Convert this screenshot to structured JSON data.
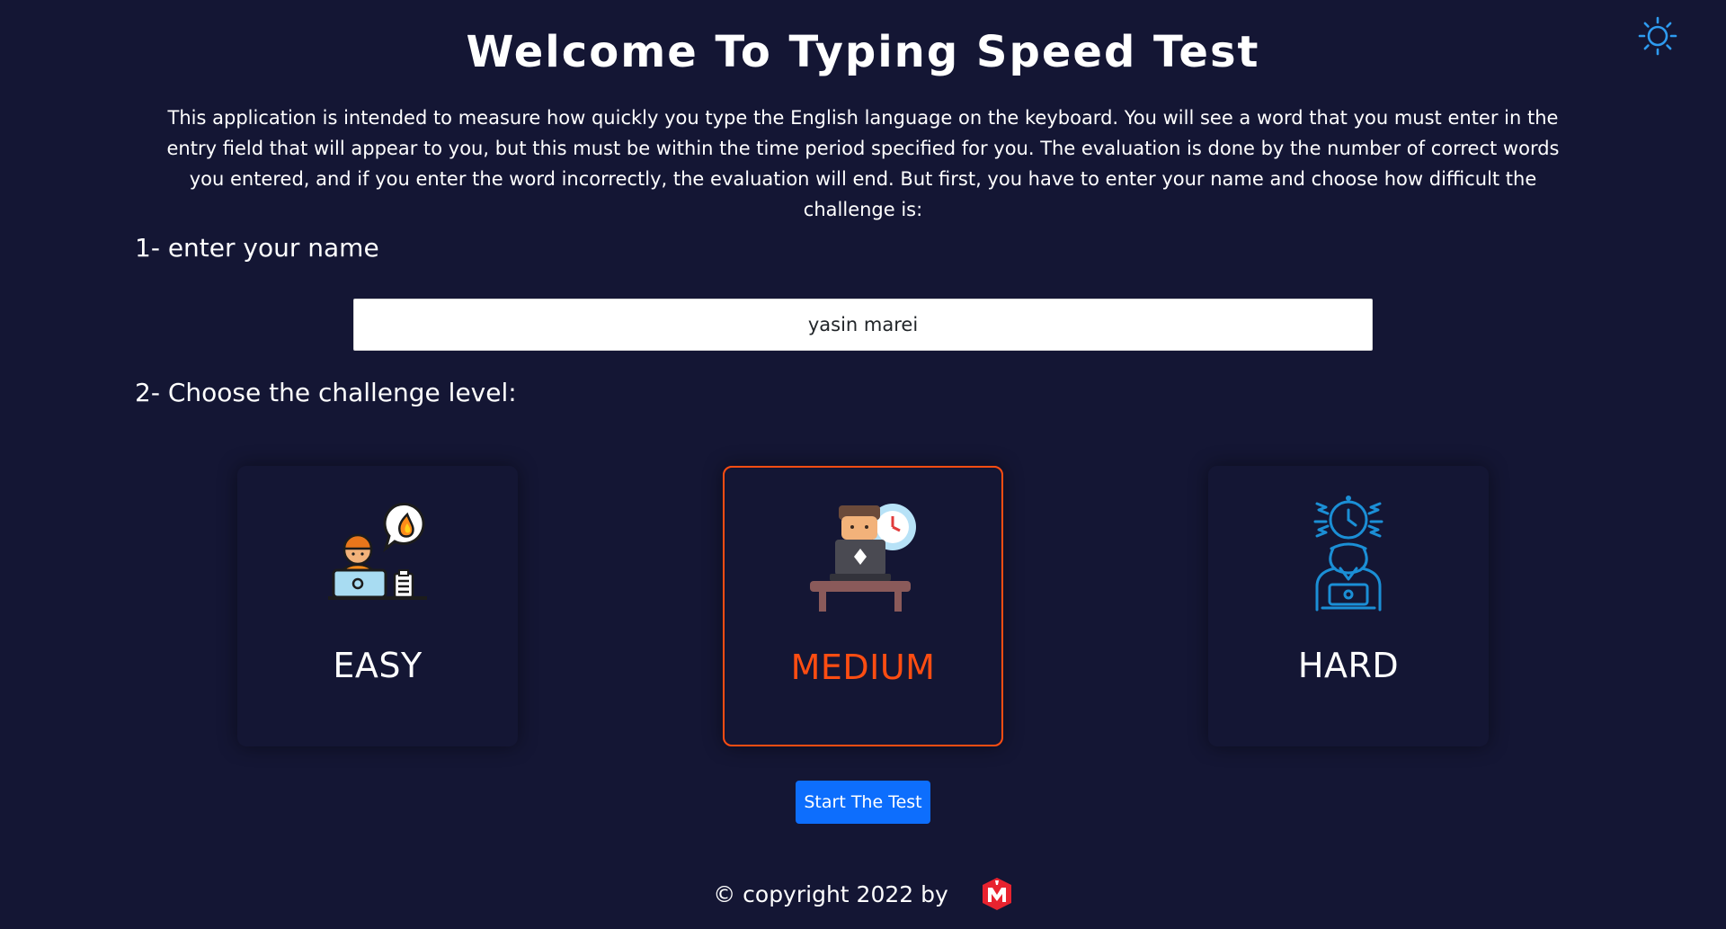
{
  "header": {
    "title": "Welcome To Typing Speed Test",
    "theme_toggle_icon": "sun-icon"
  },
  "intro": {
    "text": "This application is intended to measure how quickly you type the English language on the keyboard. You will see a word that you must enter in the entry field that will appear to you, but this must be within the time period specified for you. The evaluation is done by the number of correct words you entered, and if you enter the word incorrectly, the evaluation will end. But first, you have to enter your name and choose how difficult the challenge is:"
  },
  "step1": {
    "label": "1- enter your name",
    "name_value": "yasin marei"
  },
  "step2": {
    "label": "2- Choose the challenge level:",
    "levels": [
      {
        "label": "EASY",
        "icon": "person-laptop-fire-icon",
        "selected": false
      },
      {
        "label": "MEDIUM",
        "icon": "person-laptop-clock-icon",
        "selected": true
      },
      {
        "label": "HARD",
        "icon": "stressed-person-clock-icon",
        "selected": false
      }
    ]
  },
  "start_button": {
    "label": "Start The Test"
  },
  "footer": {
    "text": "© copyright 2022 by",
    "logo_icon": "m-brand-logo-icon"
  },
  "colors": {
    "background": "#141634",
    "selected_accent": "#ff4d12",
    "button_blue": "#0d6efd",
    "sun_icon": "#2e9bf0",
    "hard_icon": "#1b8fd6"
  }
}
